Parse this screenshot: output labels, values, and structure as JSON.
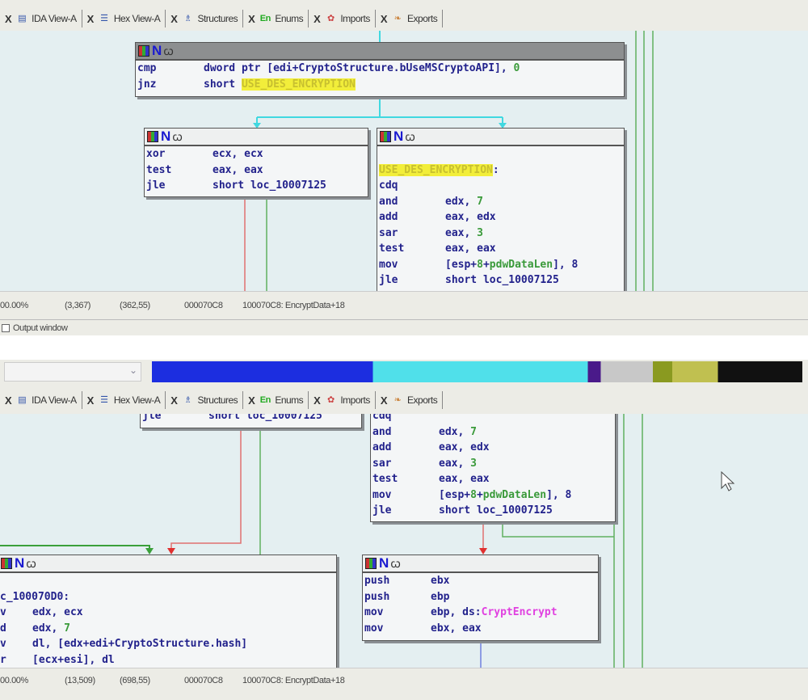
{
  "colors": {
    "graph_bg": "#e4eff1",
    "instr": "#22228c",
    "number": "#3a9a3a",
    "highlight": "#f2ee3a",
    "api": "#e040e0",
    "edge_true": "#3aa03a",
    "edge_false": "#e03030",
    "edge_flow": "#40d8e0"
  },
  "tabs": [
    {
      "label": "IDA View-A",
      "icon": "ida-view-icon"
    },
    {
      "label": "Hex View-A",
      "icon": "hex-view-icon"
    },
    {
      "label": "Structures",
      "icon": "structures-icon"
    },
    {
      "label": "Enums",
      "icon": "enums-icon",
      "icon_text": "En"
    },
    {
      "label": "Imports",
      "icon": "imports-icon"
    },
    {
      "label": "Exports",
      "icon": "exports-icon"
    }
  ],
  "tab_close": "X",
  "node_header": {
    "n": "N",
    "w": "ꞷ"
  },
  "top": {
    "nodes": [
      {
        "id": "cmp-block",
        "lines": [
          {
            "m": "cmp",
            "o": [
              {
                "t": "dword ptr [edi+CryptoStructure.bUseMSCryptoAPI], "
              },
              {
                "t": "0",
                "c": "num"
              }
            ]
          },
          {
            "m": "jnz",
            "o": [
              {
                "t": "short "
              },
              {
                "t": "USE_DES_ENCRYPTION",
                "c": "hl"
              }
            ]
          }
        ]
      },
      {
        "id": "xor-block",
        "lines": [
          {
            "m": "xor",
            "o": [
              {
                "t": "ecx, ecx"
              }
            ]
          },
          {
            "m": "test",
            "o": [
              {
                "t": "eax, eax"
              }
            ]
          },
          {
            "m": "jle",
            "o": [
              {
                "t": "short loc_10007125"
              }
            ]
          }
        ]
      },
      {
        "id": "des-block",
        "lines": [
          {
            "m": "",
            "o": []
          },
          {
            "m": "",
            "o": [
              {
                "t": "USE_DES_ENCRYPTION",
                "c": "hl"
              },
              {
                "t": ":"
              }
            ],
            "label": true
          },
          {
            "m": "cdq",
            "o": []
          },
          {
            "m": "and",
            "o": [
              {
                "t": "edx, "
              },
              {
                "t": "7",
                "c": "num"
              }
            ]
          },
          {
            "m": "add",
            "o": [
              {
                "t": "eax, edx"
              }
            ]
          },
          {
            "m": "sar",
            "o": [
              {
                "t": "eax, "
              },
              {
                "t": "3",
                "c": "num"
              }
            ]
          },
          {
            "m": "test",
            "o": [
              {
                "t": "eax, eax"
              }
            ]
          },
          {
            "m": "mov",
            "o": [
              {
                "t": "[esp+"
              },
              {
                "t": "8",
                "c": "num"
              },
              {
                "t": "+"
              },
              {
                "t": "pdwDataLen",
                "c": "var"
              },
              {
                "t": "], 8"
              }
            ]
          },
          {
            "m": "jle",
            "o": [
              {
                "t": "short loc_10007125"
              }
            ]
          }
        ]
      }
    ],
    "status": [
      "00.00%",
      "(3,367)",
      "(362,55)",
      "000070C8",
      "100070C8: EncryptData+18"
    ],
    "output_window": "Output window"
  },
  "bottom": {
    "nodes": [
      {
        "id": "jle-block",
        "lines": [
          {
            "m": "jle",
            "o": [
              {
                "t": "short loc_10007125"
              }
            ]
          }
        ]
      },
      {
        "id": "des-block",
        "lines": [
          {
            "m": "cdq",
            "o": []
          },
          {
            "m": "and",
            "o": [
              {
                "t": "edx, "
              },
              {
                "t": "7",
                "c": "num"
              }
            ]
          },
          {
            "m": "add",
            "o": [
              {
                "t": "eax, edx"
              }
            ]
          },
          {
            "m": "sar",
            "o": [
              {
                "t": "eax, "
              },
              {
                "t": "3",
                "c": "num"
              }
            ]
          },
          {
            "m": "test",
            "o": [
              {
                "t": "eax, eax"
              }
            ]
          },
          {
            "m": "mov",
            "o": [
              {
                "t": "[esp+"
              },
              {
                "t": "8",
                "c": "num"
              },
              {
                "t": "+"
              },
              {
                "t": "pdwDataLen",
                "c": "var"
              },
              {
                "t": "], 8"
              }
            ]
          },
          {
            "m": "jle",
            "o": [
              {
                "t": "short loc_10007125"
              }
            ]
          }
        ]
      },
      {
        "id": "loop-block",
        "lines": [
          {
            "m": "",
            "o": []
          },
          {
            "m": "",
            "o": [
              {
                "t": "c_100070D0:"
              }
            ],
            "label": true
          },
          {
            "m": "v",
            "o": [
              {
                "t": "edx, ecx"
              }
            ],
            "short": true
          },
          {
            "m": "d",
            "o": [
              {
                "t": "edx, "
              },
              {
                "t": "7",
                "c": "num"
              }
            ],
            "short": true
          },
          {
            "m": "v",
            "o": [
              {
                "t": "dl, [edx+edi+CryptoStructure.hash]"
              }
            ],
            "short": true
          },
          {
            "m": "r",
            "o": [
              {
                "t": "[ecx+esi], dl"
              }
            ],
            "short": true
          }
        ]
      },
      {
        "id": "crypt-block",
        "lines": [
          {
            "m": "push",
            "o": [
              {
                "t": "ebx"
              }
            ]
          },
          {
            "m": "push",
            "o": [
              {
                "t": "ebp"
              }
            ]
          },
          {
            "m": "mov",
            "o": [
              {
                "t": "ebp, ds:"
              },
              {
                "t": "CryptEncrypt",
                "c": "api"
              }
            ]
          },
          {
            "m": "mov",
            "o": [
              {
                "t": "ebx, eax"
              }
            ]
          }
        ]
      }
    ],
    "status": [
      "00.00%",
      "(13,509)",
      "(698,55)",
      "000070C8",
      "100070C8: EncryptData+18"
    ]
  }
}
